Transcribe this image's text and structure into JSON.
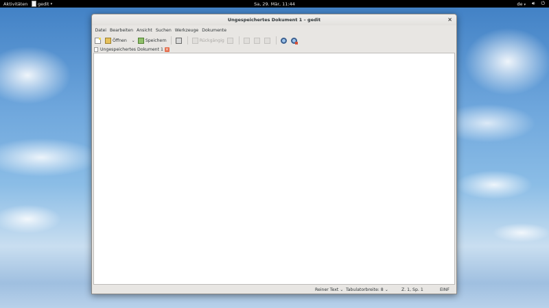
{
  "topbar": {
    "activities": "Aktivitäten",
    "app_name": "gedit",
    "clock": "Sa, 29. Mär, 11:44",
    "language": "de"
  },
  "window": {
    "title": "Ungespeichertes Dokument 1 – gedit",
    "close": "×"
  },
  "menu": [
    "Datei",
    "Bearbeiten",
    "Ansicht",
    "Suchen",
    "Werkzeuge",
    "Dokumente"
  ],
  "toolbar": {
    "open_label": "Öffnen",
    "save_label": "Speichern",
    "undo_label": "Rückgängig"
  },
  "tab": {
    "label": "Ungespeichertes Dokument 1",
    "close": "×"
  },
  "statusbar": {
    "language": "Reiner Text",
    "tab_width": "Tabulatorbreite: 8",
    "position": "Z. 1, Sp. 1",
    "mode": "EINF"
  },
  "icons": {
    "new": "new-document-icon",
    "open": "open-folder-icon",
    "save": "save-icon",
    "print": "print-icon",
    "undo": "undo-icon",
    "redo": "redo-icon",
    "cut": "cut-icon",
    "copy": "copy-icon",
    "paste": "paste-icon",
    "find": "search-icon",
    "replace": "search-replace-icon"
  }
}
